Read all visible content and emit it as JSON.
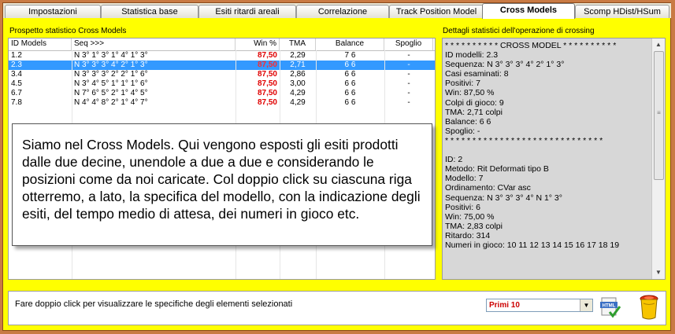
{
  "tabs": [
    {
      "label": "Impostazioni"
    },
    {
      "label": "Statistica base"
    },
    {
      "label": "Esiti ritardi areali"
    },
    {
      "label": "Correlazione"
    },
    {
      "label": "Track Position Model"
    },
    {
      "label": "Cross Models",
      "active": true
    },
    {
      "label": "Scomp HDist/HSum"
    }
  ],
  "left_panel": {
    "title": "Prospetto statistico Cross Models",
    "columns": [
      "ID Models",
      "Seq >>>",
      "Win %",
      "TMA",
      "Balance",
      "Spoglio"
    ],
    "rows": [
      {
        "id": "1.2",
        "seq": "N 3° 1° 3° 1° 4° 1° 3°",
        "win": "87,50",
        "tma": "2,29",
        "balance": "7 6",
        "spoglio": "-",
        "selected": false
      },
      {
        "id": "2.3",
        "seq": "N 3° 3° 3° 4° 2° 1° 3°",
        "win": "87,50",
        "tma": "2,71",
        "balance": "6 6",
        "spoglio": "-",
        "selected": true
      },
      {
        "id": "3.4",
        "seq": "N 3° 3° 3° 2° 2° 1° 6°",
        "win": "87,50",
        "tma": "2,86",
        "balance": "6 6",
        "spoglio": "-",
        "selected": false
      },
      {
        "id": "4.5",
        "seq": "N 3° 4° 5° 1° 1° 1° 6°",
        "win": "87,50",
        "tma": "3,00",
        "balance": "6 6",
        "spoglio": "-",
        "selected": false
      },
      {
        "id": "6.7",
        "seq": "N 7° 6° 5° 2° 1° 4° 5°",
        "win": "87,50",
        "tma": "4,29",
        "balance": "6 6",
        "spoglio": "-",
        "selected": false
      },
      {
        "id": "7.8",
        "seq": "N 4° 4° 8° 2° 1° 4° 7°",
        "win": "87,50",
        "tma": "4,29",
        "balance": "6 6",
        "spoglio": "-",
        "selected": false
      }
    ]
  },
  "right_panel": {
    "title": "Dettagli statistici dell'operazione di crossing",
    "lines": [
      "* * * * * * * * * * CROSS MODEL * * * * * * * * * *",
      "ID modelli: 2.3",
      "Sequenza:  N 3° 3° 3° 4° 2° 1° 3°",
      "Casi esaminati: 8",
      "Positivi: 7",
      "Win:  87,50 %",
      "Colpi di gioco: 9",
      "TMA:  2,71 colpi",
      "Balance: 6 6",
      "Spoglio: -",
      "* * * * * * * * * * * * * * * * * * * * * * * * * * * * *",
      "",
      "ID: 2",
      "Metodo: Rit Deformati tipo B",
      "Modello: 7",
      "Ordinamento: CVar asc",
      "Sequenza: N 3° 3° 3° 4° N 1° 3°",
      "Positivi: 6",
      "Win:  75,00 %",
      "TMA: 2,83 colpi",
      "Ritardo: 314",
      "Numeri in gioco: 10 11 12 13 14 15 16 17 18 19"
    ]
  },
  "bottom": {
    "hint": "Fare doppio click per visualizzare le specifiche degli elementi selezionati",
    "select_value": "Primi 10"
  },
  "tooltip": {
    "text": "Siamo nel Cross Models. Qui vengono esposti gli esiti prodotti dalle due decine, unendole a due a due e considerando le posizioni come da noi caricate. Col doppio click su ciascuna riga otterremo, a lato, la specifica del modello, con la indicazione degli esiti, del tempo medio di attesa, dei numeri in gioco etc."
  },
  "colors": {
    "frame_bg": "#ffff00",
    "outer_bg": "#c97a44",
    "selection": "#3399ff",
    "win_red": "#e00000"
  }
}
